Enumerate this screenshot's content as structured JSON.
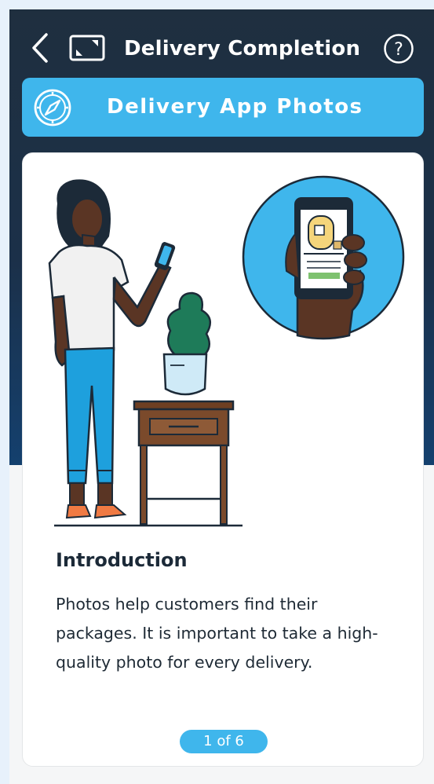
{
  "header": {
    "title": "Delivery Completion",
    "back_icon": "chevron-left-icon",
    "expand_icon": "expand-icon",
    "help_icon": "question-circle-icon",
    "help_glyph": "?"
  },
  "banner": {
    "label": "Delivery App Photos",
    "icon": "compass-icon"
  },
  "card": {
    "title": "Introduction",
    "body": "Photos help customers find their packages. It is important to take a high-quality photo for every delivery.",
    "pager": "1 of 6"
  },
  "colors": {
    "header_dark": "#1f2f3f",
    "header_blue": "#14406e",
    "accent": "#3fb6ec",
    "card": "#ffffff",
    "text": "#1c2a38"
  }
}
